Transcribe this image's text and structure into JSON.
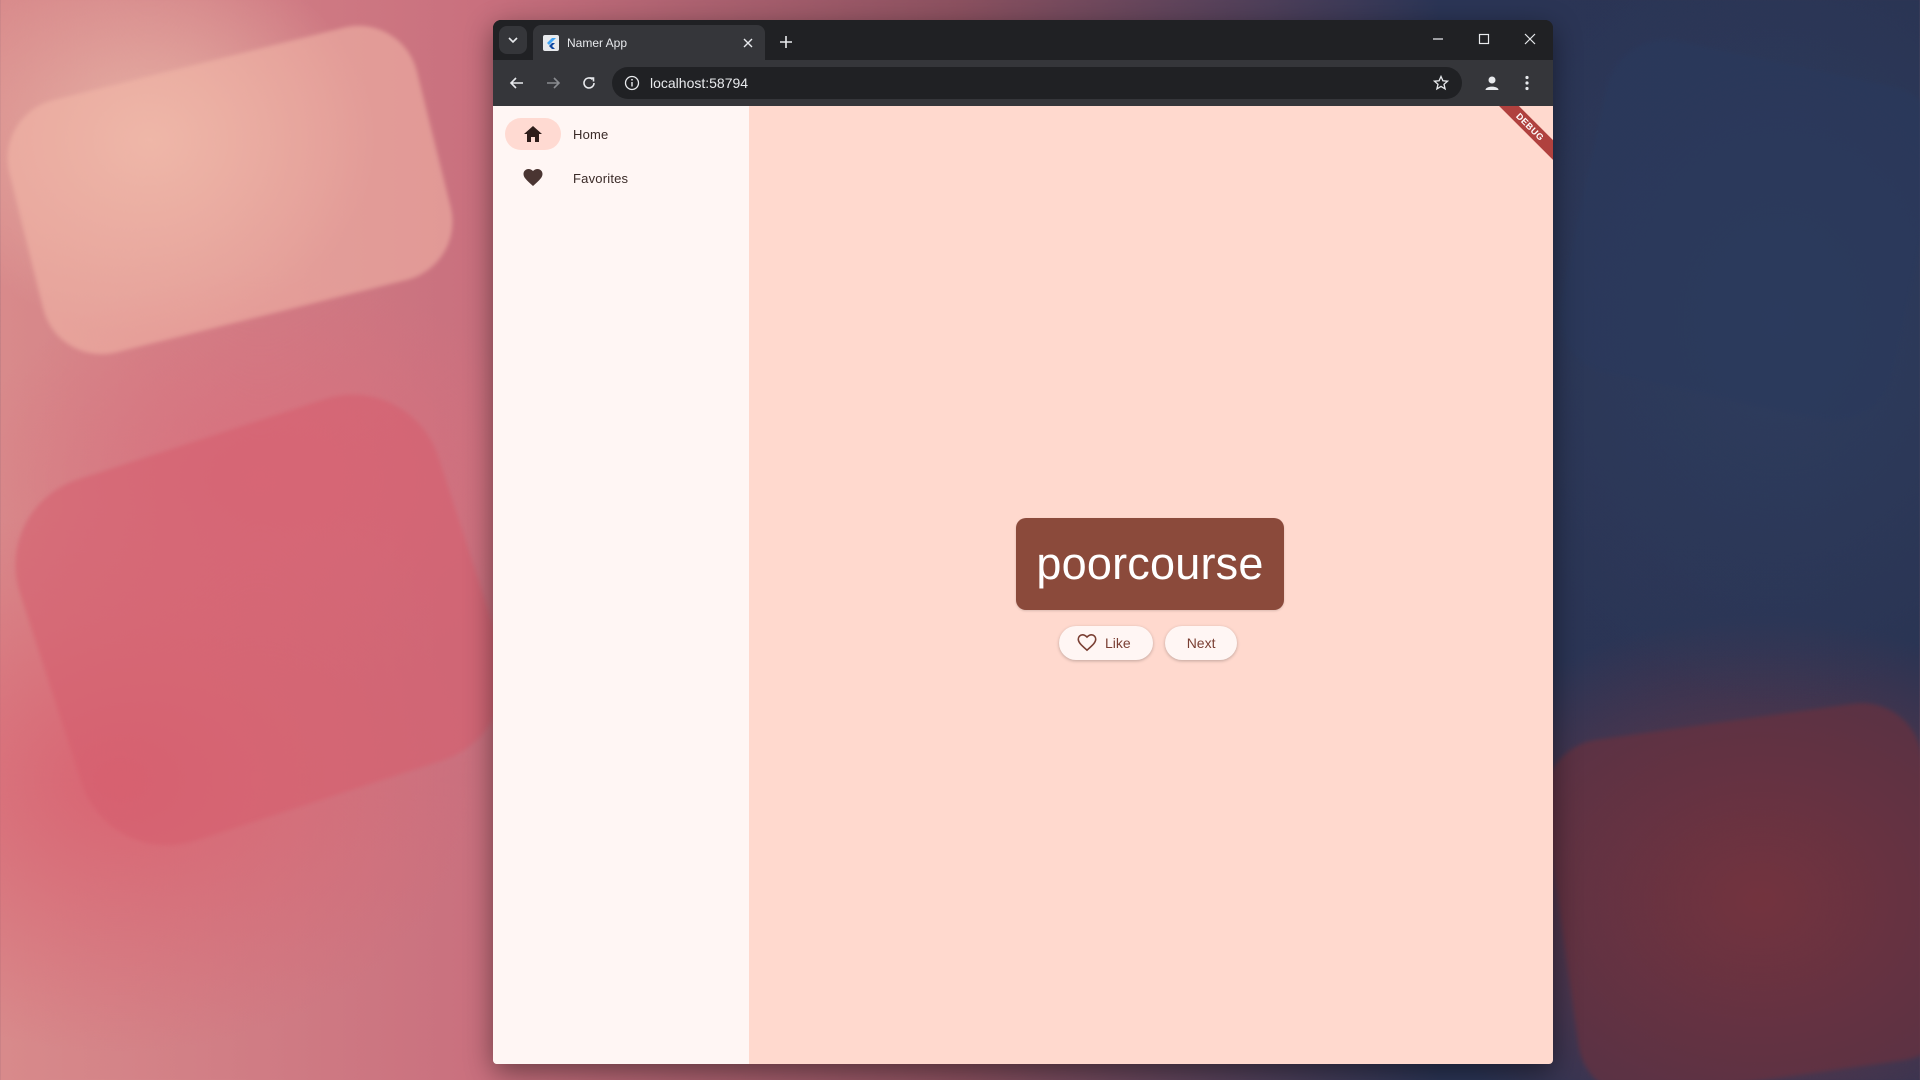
{
  "browser": {
    "tab_title": "Namer App",
    "url": "localhost:58794"
  },
  "nav_rail": {
    "items": [
      {
        "label": "Home",
        "icon": "home-icon",
        "selected": true
      },
      {
        "label": "Favorites",
        "icon": "heart-icon",
        "selected": false
      }
    ]
  },
  "main": {
    "word": "poorcourse",
    "like_label": "Like",
    "next_label": "Next"
  },
  "debug_banner": "DEBUG",
  "colors": {
    "page_bg": "#ffd9ce",
    "rail_bg": "#fff6f4",
    "card_bg": "#8b4a3b",
    "accent_text": "#7a3f33",
    "banner": "#b0413e"
  }
}
